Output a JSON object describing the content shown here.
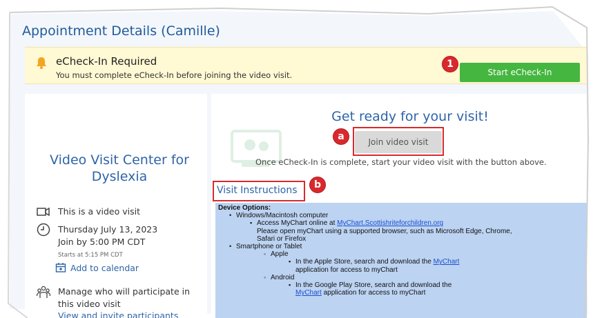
{
  "header": {
    "title": "Appointment Details (Camille)"
  },
  "banner": {
    "heading": "eCheck-In Required",
    "text": "You must complete eCheck-In before joining the video visit.",
    "button_label": "Start eCheck-In",
    "icon": "bell-icon"
  },
  "markers": {
    "one": "1",
    "a": "a",
    "b": "b"
  },
  "left_panel": {
    "center_name": "Video Visit Center for Dyslexia",
    "video_text": "This is a video visit",
    "date": "Thursday July 13, 2023",
    "join_by": "Join by 5:00 PM CDT",
    "starts_at": "Starts at 5:15 PM CDT",
    "add_calendar": "Add to calendar",
    "manage_line1": "Manage who will participate in",
    "manage_line2": "this video visit",
    "view_invite": "View and invite participants"
  },
  "right_panel": {
    "heading": "Get ready for your visit!",
    "join_button": "Join video visit",
    "join_note": "Once eCheck-In is complete, start your video visit with the button above.",
    "instructions_title": "Visit Instructions"
  },
  "instructions": {
    "device_options": "Device Options:",
    "windows": "Windows/Macintosh computer",
    "access_prefix": "Access MyChart online at ",
    "access_link": "MyChart.Scottishriteforchildren.org",
    "browser_note": "Please open myChart using a supported browser, such as Microsoft Edge, Chrome,",
    "browser_note2": "Safari or Firefox",
    "smartphone": "Smartphone or Tablet",
    "apple": "Apple",
    "apple_prefix": "In the Apple Store, search and download the ",
    "apple_link": "MyChart",
    "apple_suffix": "application for access to myChart",
    "android": "Android",
    "android_text": "In the Google Play Store, search and download the",
    "android_link": "MyChart",
    "android_suffix": " application for access to myChart"
  },
  "colors": {
    "accent_blue": "#2e64a8",
    "start_green": "#45b63f",
    "marker_red": "#d9292d",
    "banner_yellow": "#fff9d4",
    "instructions_bg": "#bcd3f2"
  }
}
